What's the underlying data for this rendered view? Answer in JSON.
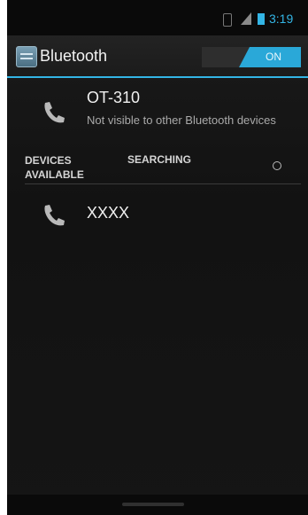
{
  "status_bar": {
    "time": "3:19",
    "icons": [
      "bluetooth-icon",
      "signal-icon",
      "battery-icon"
    ]
  },
  "action_bar": {
    "title": "Bluetooth",
    "toggle_label": "ON",
    "accent_color": "#33b5e5"
  },
  "this_device": {
    "name": "OT-310",
    "status": "Not visible to other Bluetooth devices",
    "icon": "phone-icon"
  },
  "devices_section": {
    "title": "DEVICES AVAILABLE",
    "status": "SEARCHING"
  },
  "available_devices": [
    {
      "name": "XXXX",
      "icon": "phone-icon"
    }
  ]
}
